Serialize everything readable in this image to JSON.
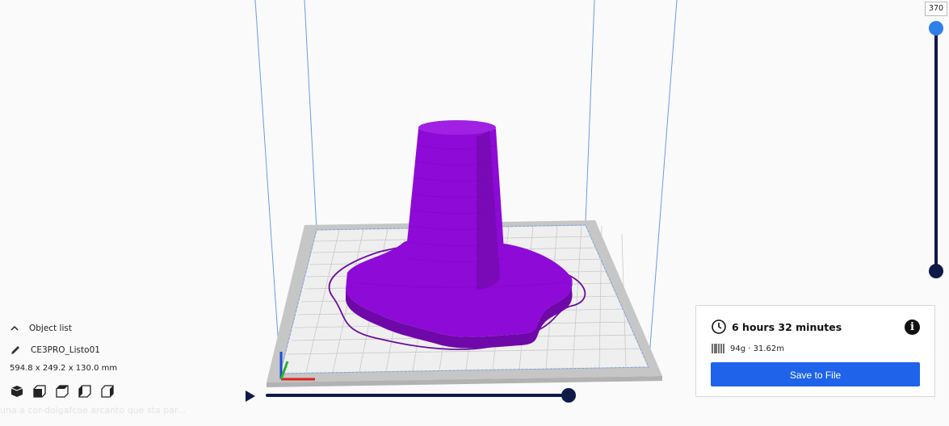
{
  "object_list": {
    "header_label": "Object list",
    "object_name": "CE3PRO_Listo01",
    "dimensions": "594.8 x 249.2 x 130.0 mm",
    "view_buttons": [
      "view-3d-icon",
      "view-front-icon",
      "view-top-icon",
      "view-left-icon",
      "view-right-icon"
    ]
  },
  "layer_slider": {
    "current_layer": "370"
  },
  "print_info": {
    "time": "6 hours 32 minutes",
    "material": "94g · 31.62m",
    "save_label": "Save to File"
  },
  "ghost_text": "una a cor-doigafcoe arcanto que sta par...",
  "colors": {
    "model": "#8e0ad6",
    "build_plate": "#c4c4c4",
    "accent": "#1e63e9",
    "dark": "#0e1a48"
  }
}
